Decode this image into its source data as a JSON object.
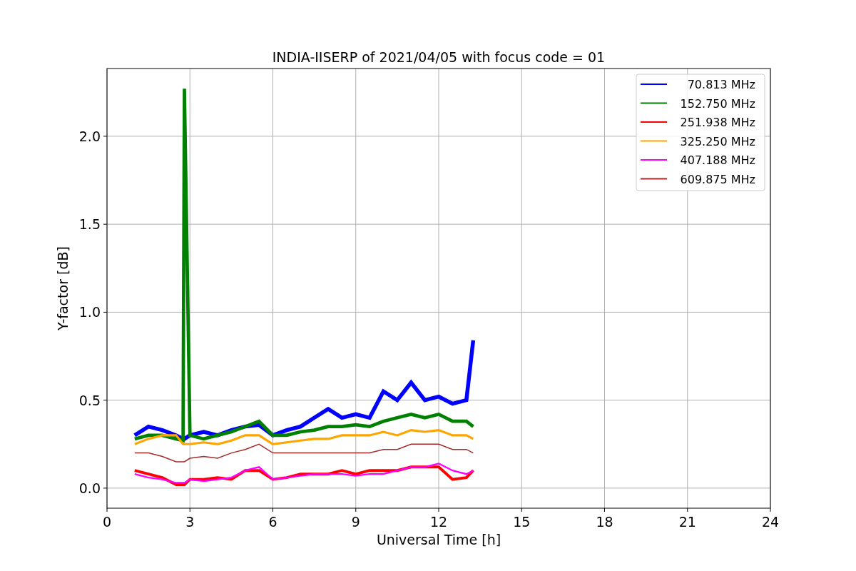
{
  "chart_data": {
    "type": "line",
    "title": "INDIA-IISERP of 2021/04/05 with focus code = 01",
    "xlabel": "Universal Time [h]",
    "ylabel": "Y-factor [dB]",
    "x": [
      1,
      1.5,
      2,
      2.5,
      2.75,
      2.8,
      3,
      3.5,
      4,
      4.5,
      5,
      5.5,
      6,
      6.5,
      7,
      7.5,
      8,
      8.5,
      9,
      9.5,
      10,
      10.5,
      11,
      11.5,
      12,
      12.5,
      13,
      13.25
    ],
    "series": [
      {
        "name": "70.813 MHz",
        "color": "#0000ff",
        "values": [
          0.3,
          0.35,
          0.33,
          0.3,
          0.28,
          0.28,
          0.3,
          0.32,
          0.3,
          0.33,
          0.35,
          0.36,
          0.3,
          0.33,
          0.35,
          0.4,
          0.45,
          0.4,
          0.42,
          0.4,
          0.55,
          0.5,
          0.6,
          0.5,
          0.52,
          0.48,
          0.5,
          0.84
        ]
      },
      {
        "name": "152.750 MHz",
        "color": "#008000",
        "values": [
          0.28,
          0.3,
          0.3,
          0.28,
          0.27,
          2.27,
          0.3,
          0.28,
          0.3,
          0.32,
          0.35,
          0.38,
          0.3,
          0.3,
          0.32,
          0.33,
          0.35,
          0.35,
          0.36,
          0.35,
          0.38,
          0.4,
          0.42,
          0.4,
          0.42,
          0.38,
          0.38,
          0.35
        ]
      },
      {
        "name": "251.938 MHz",
        "color": "#ff0000",
        "values": [
          0.1,
          0.08,
          0.06,
          0.02,
          0.02,
          0.02,
          0.05,
          0.05,
          0.06,
          0.05,
          0.1,
          0.1,
          0.05,
          0.06,
          0.08,
          0.08,
          0.08,
          0.1,
          0.08,
          0.1,
          0.1,
          0.1,
          0.12,
          0.12,
          0.12,
          0.05,
          0.06,
          0.1
        ]
      },
      {
        "name": "325.250 MHz",
        "color": "#ffa500",
        "values": [
          0.25,
          0.28,
          0.3,
          0.3,
          0.25,
          0.25,
          0.25,
          0.26,
          0.25,
          0.27,
          0.3,
          0.3,
          0.25,
          0.26,
          0.27,
          0.28,
          0.28,
          0.3,
          0.3,
          0.3,
          0.32,
          0.3,
          0.33,
          0.32,
          0.33,
          0.3,
          0.3,
          0.28
        ]
      },
      {
        "name": "407.188 MHz",
        "color": "#ff00ff",
        "values": [
          0.08,
          0.06,
          0.05,
          0.03,
          0.03,
          0.03,
          0.05,
          0.04,
          0.05,
          0.06,
          0.1,
          0.12,
          0.05,
          0.06,
          0.07,
          0.08,
          0.08,
          0.08,
          0.07,
          0.08,
          0.08,
          0.1,
          0.12,
          0.12,
          0.14,
          0.1,
          0.08,
          0.1
        ]
      },
      {
        "name": "609.875 MHz",
        "color": "#a52a2a",
        "values": [
          0.2,
          0.2,
          0.18,
          0.15,
          0.15,
          0.15,
          0.17,
          0.18,
          0.17,
          0.2,
          0.22,
          0.25,
          0.2,
          0.2,
          0.2,
          0.2,
          0.2,
          0.2,
          0.2,
          0.2,
          0.22,
          0.22,
          0.25,
          0.25,
          0.25,
          0.22,
          0.22,
          0.2
        ]
      }
    ],
    "grid": true,
    "legend": true,
    "xlim": [
      0,
      24
    ],
    "ylim": [
      -0.114,
      2.385
    ],
    "xticks": [
      0,
      3,
      6,
      9,
      12,
      15,
      18,
      21,
      24
    ],
    "yticks": [
      {
        "value": 0,
        "label": "0.0"
      },
      {
        "value": 0.5,
        "label": "0.5"
      },
      {
        "value": 1,
        "label": "1.0"
      },
      {
        "value": 1.5,
        "label": "1.5"
      },
      {
        "value": 2,
        "label": "2.0"
      }
    ]
  }
}
